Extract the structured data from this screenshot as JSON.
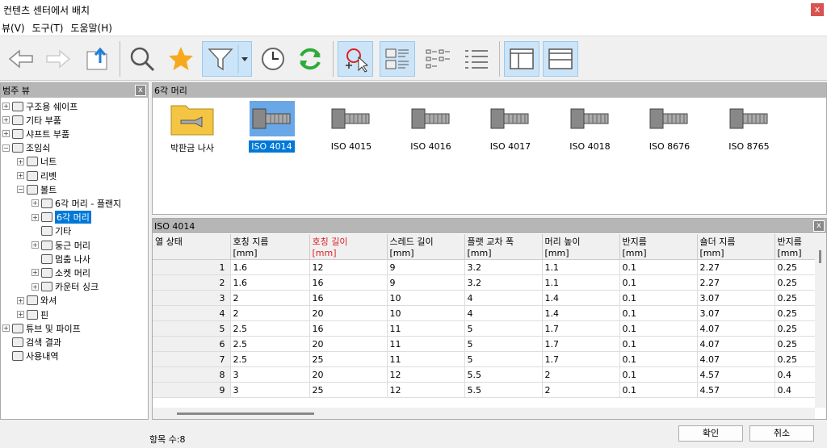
{
  "window": {
    "title": "컨텐츠 센터에서 배치",
    "close": "x"
  },
  "menu": [
    "뷰(V)",
    "도구(T)",
    "도움말(H)"
  ],
  "left_panel": {
    "title": "범주 뷰",
    "close": "x",
    "items": [
      {
        "label": "구조용 쉐이프",
        "level": 0,
        "exp": "+"
      },
      {
        "label": "기타 부품",
        "level": 0,
        "exp": "+"
      },
      {
        "label": "샤프트 부품",
        "level": 0,
        "exp": "+"
      },
      {
        "label": "조임쇠",
        "level": 0,
        "exp": "−"
      },
      {
        "label": "너트",
        "level": 1,
        "exp": "+"
      },
      {
        "label": "리벳",
        "level": 1,
        "exp": "+"
      },
      {
        "label": "볼트",
        "level": 1,
        "exp": "−"
      },
      {
        "label": "6각 머리 - 플랜지",
        "level": 2,
        "exp": "+"
      },
      {
        "label": "6각 머리",
        "level": 2,
        "exp": "+",
        "selected": true
      },
      {
        "label": "기타",
        "level": 2,
        "exp": ""
      },
      {
        "label": "둥근 머리",
        "level": 2,
        "exp": "+"
      },
      {
        "label": "멈춤 나사",
        "level": 2,
        "exp": ""
      },
      {
        "label": "소켓 머리",
        "level": 2,
        "exp": "+"
      },
      {
        "label": "카운터 싱크",
        "level": 2,
        "exp": "+"
      },
      {
        "label": "와셔",
        "level": 1,
        "exp": "+"
      },
      {
        "label": "핀",
        "level": 1,
        "exp": "+"
      },
      {
        "label": "튜브 및 파이프",
        "level": 0,
        "exp": "+"
      },
      {
        "label": "검색 결과",
        "level": 0,
        "exp": ""
      },
      {
        "label": "사용내역",
        "level": 0,
        "exp": ""
      }
    ]
  },
  "top_panel": {
    "title": "6각 머리",
    "items": [
      {
        "label": "박판금 나사",
        "type": "folder"
      },
      {
        "label": "ISO 4014",
        "selected": true
      },
      {
        "label": "ISO 4015"
      },
      {
        "label": "ISO 4016"
      },
      {
        "label": "ISO 4017"
      },
      {
        "label": "ISO 4018"
      },
      {
        "label": "ISO 8676"
      },
      {
        "label": "ISO 8765"
      }
    ]
  },
  "bottom_panel": {
    "title": "ISO 4014",
    "close": "x",
    "columns": [
      {
        "name": "열 상태",
        "unit": ""
      },
      {
        "name": "호칭 지름",
        "unit": "[mm]"
      },
      {
        "name": "호칭 길이",
        "unit": "[mm]",
        "highlight": true
      },
      {
        "name": "스레드 길이",
        "unit": "[mm]"
      },
      {
        "name": "플랫 교차 폭",
        "unit": "[mm]"
      },
      {
        "name": "머리 높이",
        "unit": "[mm]"
      },
      {
        "name": "반지름",
        "unit": "[mm]"
      },
      {
        "name": "숄더 지름",
        "unit": "[mm]"
      },
      {
        "name": "반지름",
        "unit": "[mm]"
      }
    ],
    "rows": [
      [
        "1",
        "1.6",
        "12",
        "9",
        "3.2",
        "1.1",
        "0.1",
        "2.27",
        "0.25"
      ],
      [
        "2",
        "1.6",
        "16",
        "9",
        "3.2",
        "1.1",
        "0.1",
        "2.27",
        "0.25"
      ],
      [
        "3",
        "2",
        "16",
        "10",
        "4",
        "1.4",
        "0.1",
        "3.07",
        "0.25"
      ],
      [
        "4",
        "2",
        "20",
        "10",
        "4",
        "1.4",
        "0.1",
        "3.07",
        "0.25"
      ],
      [
        "5",
        "2.5",
        "16",
        "11",
        "5",
        "1.7",
        "0.1",
        "4.07",
        "0.25"
      ],
      [
        "6",
        "2.5",
        "20",
        "11",
        "5",
        "1.7",
        "0.1",
        "4.07",
        "0.25"
      ],
      [
        "7",
        "2.5",
        "25",
        "11",
        "5",
        "1.7",
        "0.1",
        "4.07",
        "0.25"
      ],
      [
        "8",
        "3",
        "20",
        "12",
        "5.5",
        "2",
        "0.1",
        "4.57",
        "0.4"
      ],
      [
        "9",
        "3",
        "25",
        "12",
        "5.5",
        "2",
        "0.1",
        "4.57",
        "0.4"
      ]
    ]
  },
  "status": {
    "count_label": "항목 수:8"
  },
  "buttons": {
    "ok": "확인",
    "cancel": "취소"
  },
  "colors": {
    "accent": "#0078d7",
    "toolbar_active": "#cce4f7",
    "highlight_header": "#e02020"
  }
}
